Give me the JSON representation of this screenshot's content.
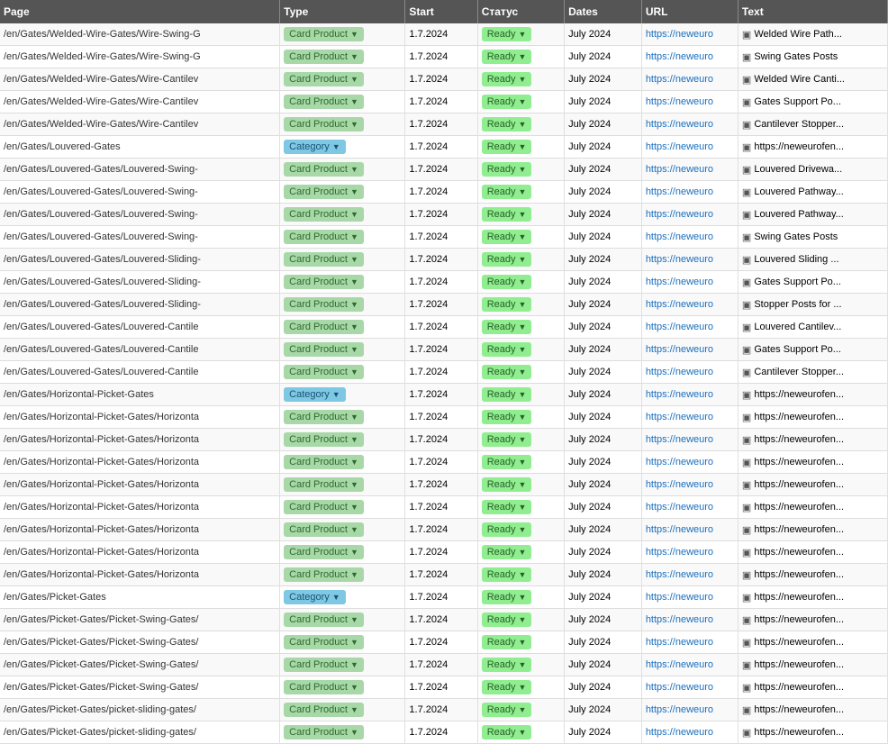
{
  "table": {
    "columns": [
      {
        "id": "page",
        "label": "Page"
      },
      {
        "id": "type",
        "label": "Type"
      },
      {
        "id": "start",
        "label": "Start"
      },
      {
        "id": "status",
        "label": "Статус"
      },
      {
        "id": "dates",
        "label": "Dates"
      },
      {
        "id": "url",
        "label": "URL"
      },
      {
        "id": "text",
        "label": "Text"
      }
    ],
    "rows": [
      {
        "page": "/en/Gates/Welded-Wire-Gates/Wire-Swing-G",
        "type": "Card Product",
        "start": "1.7.2024",
        "status": "Ready",
        "dates": "July 2024",
        "url": "https://neweuro",
        "text": "Welded Wire Path..."
      },
      {
        "page": "/en/Gates/Welded-Wire-Gates/Wire-Swing-G",
        "type": "Card Product",
        "start": "1.7.2024",
        "status": "Ready",
        "dates": "July 2024",
        "url": "https://neweuro",
        "text": "Swing Gates Posts"
      },
      {
        "page": "/en/Gates/Welded-Wire-Gates/Wire-Cantilev",
        "type": "Card Product",
        "start": "1.7.2024",
        "status": "Ready",
        "dates": "July 2024",
        "url": "https://neweuro",
        "text": "Welded Wire Canti..."
      },
      {
        "page": "/en/Gates/Welded-Wire-Gates/Wire-Cantilev",
        "type": "Card Product",
        "start": "1.7.2024",
        "status": "Ready",
        "dates": "July 2024",
        "url": "https://neweuro",
        "text": "Gates Support Po..."
      },
      {
        "page": "/en/Gates/Welded-Wire-Gates/Wire-Cantilev",
        "type": "Card Product",
        "start": "1.7.2024",
        "status": "Ready",
        "dates": "July 2024",
        "url": "https://neweuro",
        "text": "Cantilever Stopper..."
      },
      {
        "page": "/en/Gates/Louvered-Gates",
        "type": "Category",
        "start": "1.7.2024",
        "status": "Ready",
        "dates": "July 2024",
        "url": "https://neweuro",
        "text": "https://neweurofen..."
      },
      {
        "page": "/en/Gates/Louvered-Gates/Louvered-Swing-",
        "type": "Card Product",
        "start": "1.7.2024",
        "status": "Ready",
        "dates": "July 2024",
        "url": "https://neweuro",
        "text": "Louvered Drivewa..."
      },
      {
        "page": "/en/Gates/Louvered-Gates/Louvered-Swing-",
        "type": "Card Product",
        "start": "1.7.2024",
        "status": "Ready",
        "dates": "July 2024",
        "url": "https://neweuro",
        "text": "Louvered Pathway..."
      },
      {
        "page": "/en/Gates/Louvered-Gates/Louvered-Swing-",
        "type": "Card Product",
        "start": "1.7.2024",
        "status": "Ready",
        "dates": "July 2024",
        "url": "https://neweuro",
        "text": "Louvered Pathway..."
      },
      {
        "page": "/en/Gates/Louvered-Gates/Louvered-Swing-",
        "type": "Card Product",
        "start": "1.7.2024",
        "status": "Ready",
        "dates": "July 2024",
        "url": "https://neweuro",
        "text": "Swing Gates Posts"
      },
      {
        "page": "/en/Gates/Louvered-Gates/Louvered-Sliding-",
        "type": "Card Product",
        "start": "1.7.2024",
        "status": "Ready",
        "dates": "July 2024",
        "url": "https://neweuro",
        "text": "Louvered Sliding ..."
      },
      {
        "page": "/en/Gates/Louvered-Gates/Louvered-Sliding-",
        "type": "Card Product",
        "start": "1.7.2024",
        "status": "Ready",
        "dates": "July 2024",
        "url": "https://neweuro",
        "text": "Gates Support Po..."
      },
      {
        "page": "/en/Gates/Louvered-Gates/Louvered-Sliding-",
        "type": "Card Product",
        "start": "1.7.2024",
        "status": "Ready",
        "dates": "July 2024",
        "url": "https://neweuro",
        "text": "Stopper Posts for ..."
      },
      {
        "page": "/en/Gates/Louvered-Gates/Louvered-Cantile",
        "type": "Card Product",
        "start": "1.7.2024",
        "status": "Ready",
        "dates": "July 2024",
        "url": "https://neweuro",
        "text": "Louvered Cantilev..."
      },
      {
        "page": "/en/Gates/Louvered-Gates/Louvered-Cantile",
        "type": "Card Product",
        "start": "1.7.2024",
        "status": "Ready",
        "dates": "July 2024",
        "url": "https://neweuro",
        "text": "Gates Support Po..."
      },
      {
        "page": "/en/Gates/Louvered-Gates/Louvered-Cantile",
        "type": "Card Product",
        "start": "1.7.2024",
        "status": "Ready",
        "dates": "July 2024",
        "url": "https://neweuro",
        "text": "Cantilever Stopper..."
      },
      {
        "page": "/en/Gates/Horizontal-Picket-Gates",
        "type": "Category",
        "start": "1.7.2024",
        "status": "Ready",
        "dates": "July 2024",
        "url": "https://neweuro",
        "text": "https://neweurofen..."
      },
      {
        "page": "/en/Gates/Horizontal-Picket-Gates/Horizonta",
        "type": "Card Product",
        "start": "1.7.2024",
        "status": "Ready",
        "dates": "July 2024",
        "url": "https://neweuro",
        "text": "https://neweurofen..."
      },
      {
        "page": "/en/Gates/Horizontal-Picket-Gates/Horizonta",
        "type": "Card Product",
        "start": "1.7.2024",
        "status": "Ready",
        "dates": "July 2024",
        "url": "https://neweuro",
        "text": "https://neweurofen..."
      },
      {
        "page": "/en/Gates/Horizontal-Picket-Gates/Horizonta",
        "type": "Card Product",
        "start": "1.7.2024",
        "status": "Ready",
        "dates": "July 2024",
        "url": "https://neweuro",
        "text": "https://neweurofen..."
      },
      {
        "page": "/en/Gates/Horizontal-Picket-Gates/Horizonta",
        "type": "Card Product",
        "start": "1.7.2024",
        "status": "Ready",
        "dates": "July 2024",
        "url": "https://neweuro",
        "text": "https://neweurofen..."
      },
      {
        "page": "/en/Gates/Horizontal-Picket-Gates/Horizonta",
        "type": "Card Product",
        "start": "1.7.2024",
        "status": "Ready",
        "dates": "July 2024",
        "url": "https://neweuro",
        "text": "https://neweurofen..."
      },
      {
        "page": "/en/Gates/Horizontal-Picket-Gates/Horizonta",
        "type": "Card Product",
        "start": "1.7.2024",
        "status": "Ready",
        "dates": "July 2024",
        "url": "https://neweuro",
        "text": "https://neweurofen..."
      },
      {
        "page": "/en/Gates/Horizontal-Picket-Gates/Horizonta",
        "type": "Card Product",
        "start": "1.7.2024",
        "status": "Ready",
        "dates": "July 2024",
        "url": "https://neweuro",
        "text": "https://neweurofen..."
      },
      {
        "page": "/en/Gates/Horizontal-Picket-Gates/Horizonta",
        "type": "Card Product",
        "start": "1.7.2024",
        "status": "Ready",
        "dates": "July 2024",
        "url": "https://neweuro",
        "text": "https://neweurofen..."
      },
      {
        "page": "/en/Gates/Picket-Gates",
        "type": "Category",
        "start": "1.7.2024",
        "status": "Ready",
        "dates": "July 2024",
        "url": "https://neweuro",
        "text": "https://neweurofen..."
      },
      {
        "page": "/en/Gates/Picket-Gates/Picket-Swing-Gates/",
        "type": "Card Product",
        "start": "1.7.2024",
        "status": "Ready",
        "dates": "July 2024",
        "url": "https://neweuro",
        "text": "https://neweurofen..."
      },
      {
        "page": "/en/Gates/Picket-Gates/Picket-Swing-Gates/",
        "type": "Card Product",
        "start": "1.7.2024",
        "status": "Ready",
        "dates": "July 2024",
        "url": "https://neweuro",
        "text": "https://neweurofen..."
      },
      {
        "page": "/en/Gates/Picket-Gates/Picket-Swing-Gates/",
        "type": "Card Product",
        "start": "1.7.2024",
        "status": "Ready",
        "dates": "July 2024",
        "url": "https://neweuro",
        "text": "https://neweurofen..."
      },
      {
        "page": "/en/Gates/Picket-Gates/Picket-Swing-Gates/",
        "type": "Card Product",
        "start": "1.7.2024",
        "status": "Ready",
        "dates": "July 2024",
        "url": "https://neweuro",
        "text": "https://neweurofen..."
      },
      {
        "page": "/en/Gates/Picket-Gates/picket-sliding-gates/",
        "type": "Card Product",
        "start": "1.7.2024",
        "status": "Ready",
        "dates": "July 2024",
        "url": "https://neweuro",
        "text": "https://neweurofen..."
      },
      {
        "page": "/en/Gates/Picket-Gates/picket-sliding-gates/",
        "type": "Card Product",
        "start": "1.7.2024",
        "status": "Ready",
        "dates": "July 2024",
        "url": "https://neweuro",
        "text": "https://neweurofen..."
      }
    ]
  }
}
